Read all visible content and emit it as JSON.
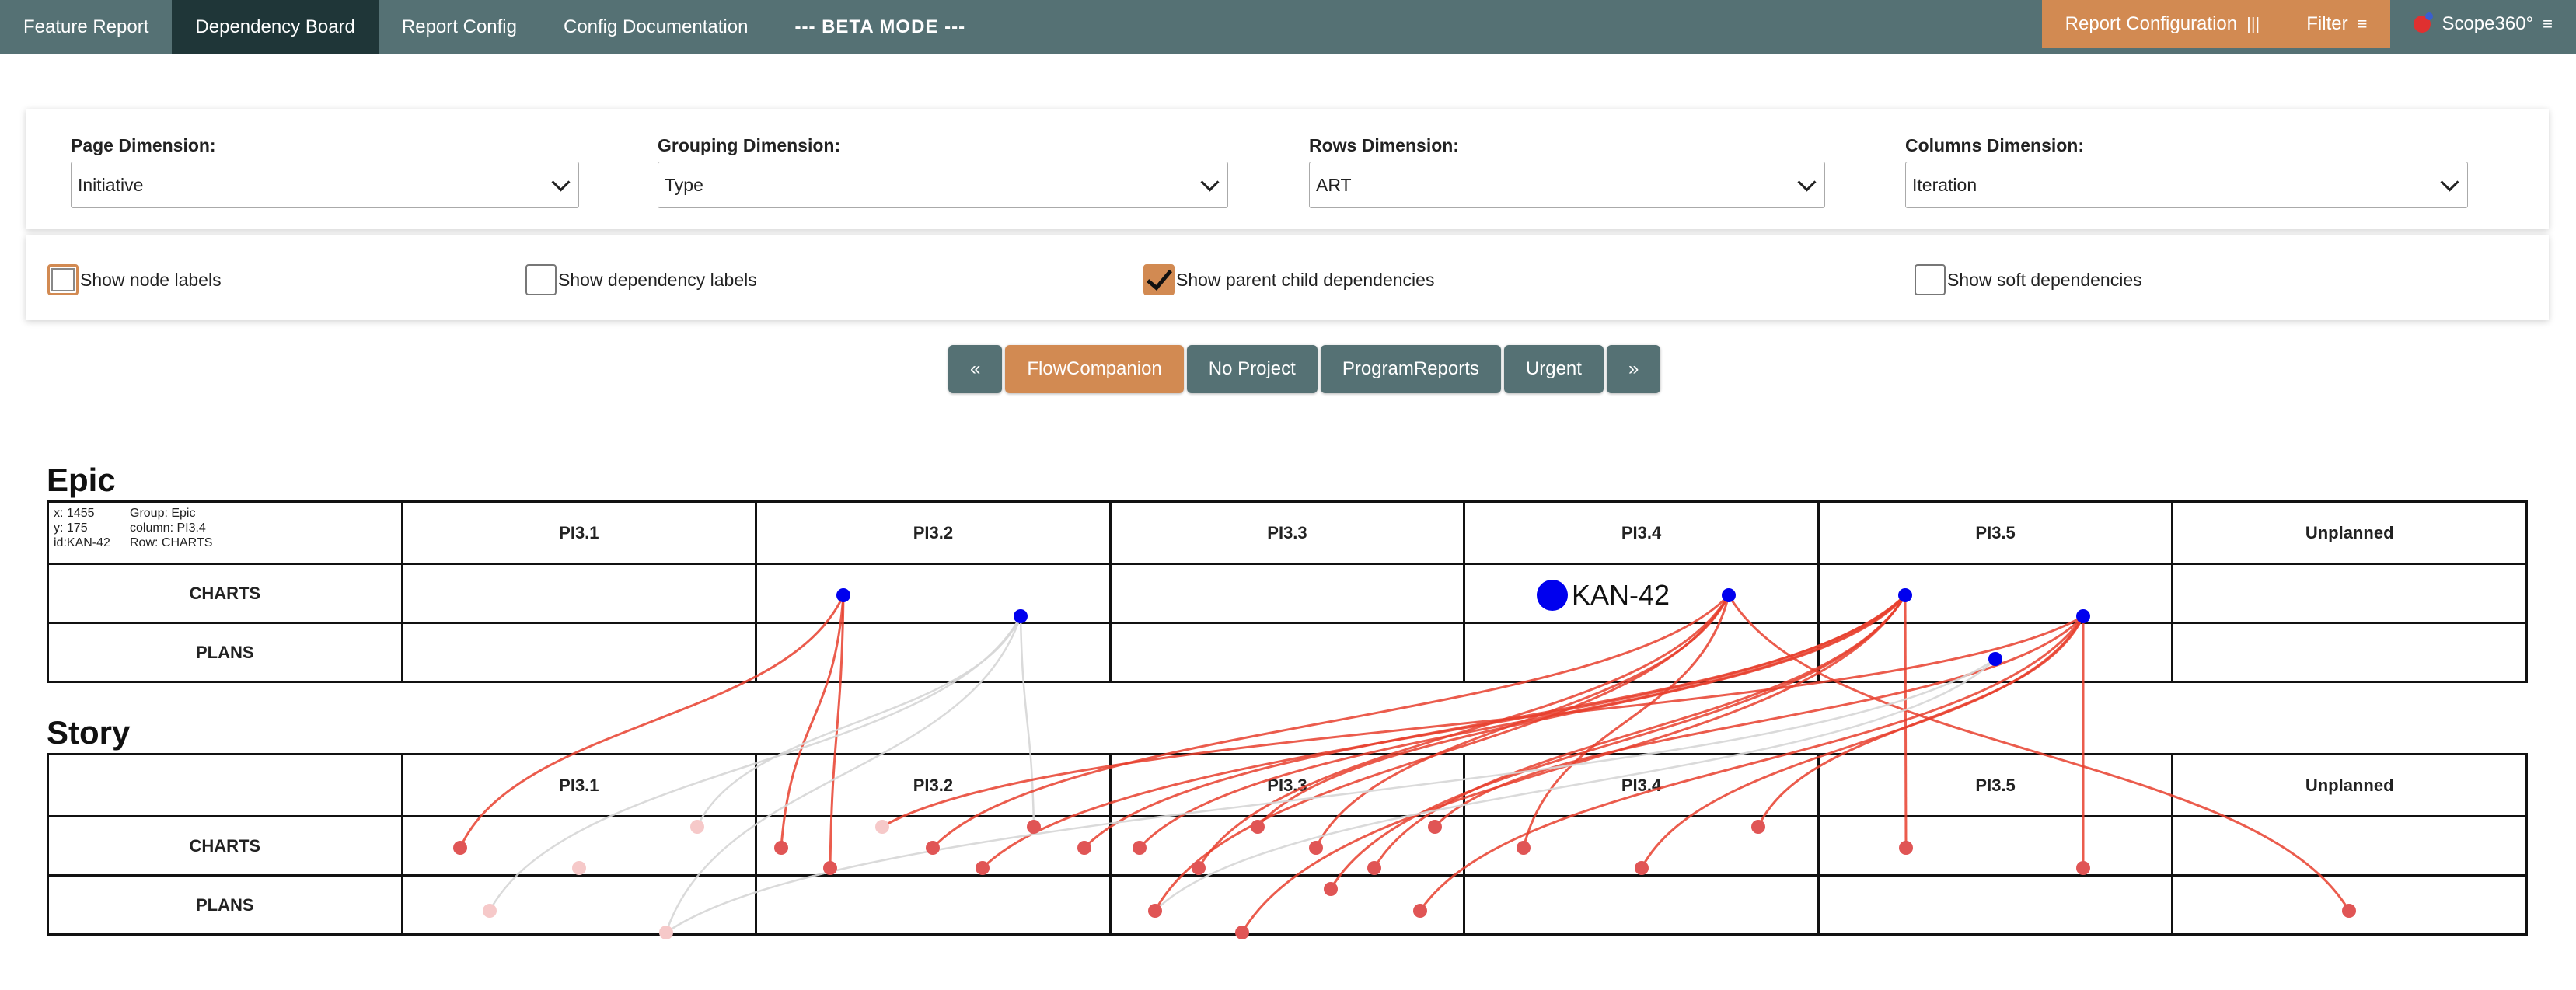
{
  "nav": {
    "items": [
      {
        "label": "Feature Report",
        "active": false
      },
      {
        "label": "Dependency Board",
        "active": true
      },
      {
        "label": "Report Config",
        "active": false
      },
      {
        "label": "Config Documentation",
        "active": false
      },
      {
        "label": "--- BETA MODE ---",
        "active": false
      }
    ],
    "report_configuration": "Report Configuration",
    "filter": "Filter",
    "brand": "Scope360°"
  },
  "dimensions": {
    "page": {
      "label": "Page Dimension:",
      "value": "Initiative"
    },
    "grouping": {
      "label": "Grouping Dimension:",
      "value": "Type"
    },
    "rows": {
      "label": "Rows Dimension:",
      "value": "ART"
    },
    "columns": {
      "label": "Columns Dimension:",
      "value": "Iteration"
    }
  },
  "options": {
    "node_labels": {
      "label": "Show node labels",
      "checked": false
    },
    "dependency_labels": {
      "label": "Show dependency labels",
      "checked": false
    },
    "parent_child": {
      "label": "Show parent child dependencies",
      "checked": true
    },
    "soft": {
      "label": "Show soft dependencies",
      "checked": false
    }
  },
  "pager": {
    "prev": "«",
    "next": "»",
    "projects": [
      "FlowCompanion",
      "No Project",
      "ProgramReports",
      "Urgent"
    ],
    "active": "FlowCompanion"
  },
  "columns": [
    "PI3.1",
    "PI3.2",
    "PI3.3",
    "PI3.4",
    "PI3.5",
    "Unplanned"
  ],
  "debug": {
    "x": "x: 1455",
    "y": "y: 175",
    "id": "id:KAN-42",
    "group": "Group: Epic",
    "column": "column: PI3.4",
    "row": "Row: CHARTS"
  },
  "groups": [
    {
      "title": "Epic",
      "rows": [
        "CHARTS",
        "PLANS"
      ]
    },
    {
      "title": "Story",
      "rows": [
        "CHARTS",
        "PLANS"
      ]
    }
  ],
  "hover_label": "KAN-42",
  "colors": {
    "header": "#557174",
    "header_active": "#1f3638",
    "accent": "#d28a52",
    "epic_node": "#0000ee",
    "story_node": "#e05555",
    "story_node_faded": "#f6c9c9",
    "link": "#e8402e",
    "link_faded": "#d6d6d6"
  }
}
